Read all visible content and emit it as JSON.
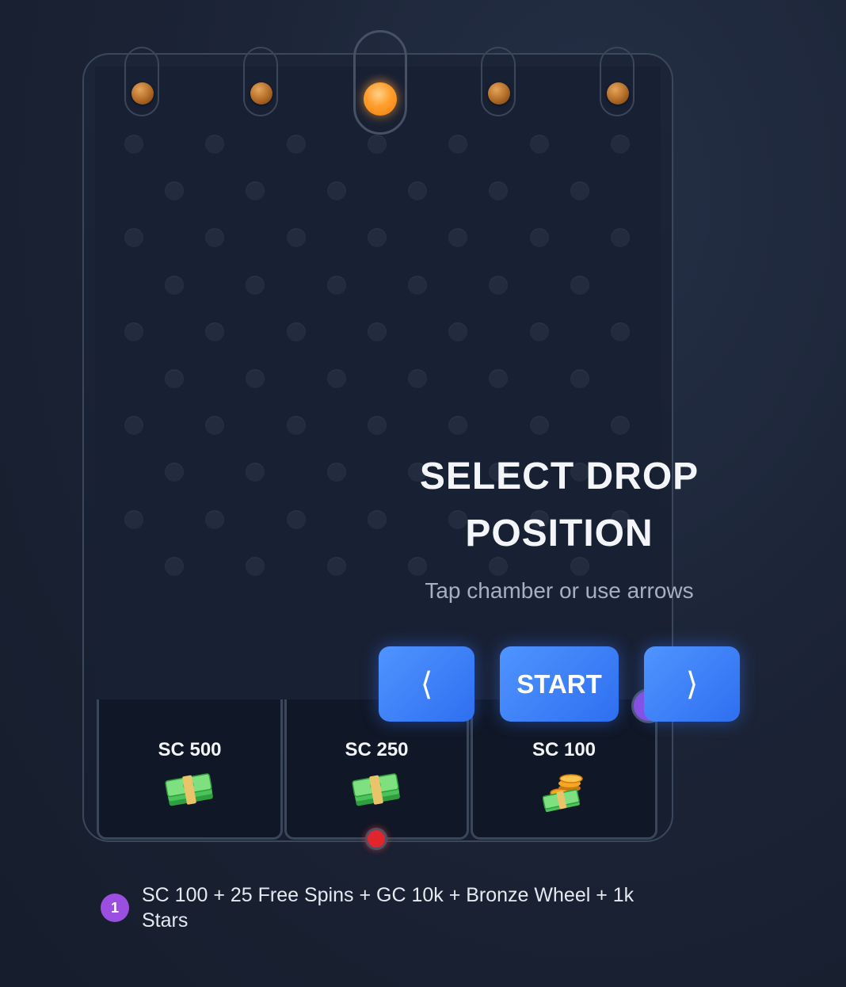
{
  "overlay": {
    "title_line1": "SELECT DROP",
    "title_line2": "POSITION",
    "subtitle": "Tap chamber or use arrows"
  },
  "controls": {
    "left_label": "⟨",
    "start_label": "START",
    "right_label": "⟩"
  },
  "chambers": {
    "count": 5,
    "selected_index": 2
  },
  "slots": [
    {
      "label": "SC 500",
      "icon": "money-stack-icon"
    },
    {
      "label": "SC 250",
      "icon": "money-stack-icon"
    },
    {
      "label": "SC 100",
      "icon": "coins-and-cash-icon"
    }
  ],
  "prize": {
    "badge": "1",
    "description": "SC 100 + 25 Free Spins + GC 10k + Bronze Wheel + 1k Stars"
  },
  "colors": {
    "accent_blue": "#3b82f6",
    "ball_orange": "#ff9d2b",
    "marker_red": "#e0262c",
    "badge_purple": "#9a4fe0"
  }
}
